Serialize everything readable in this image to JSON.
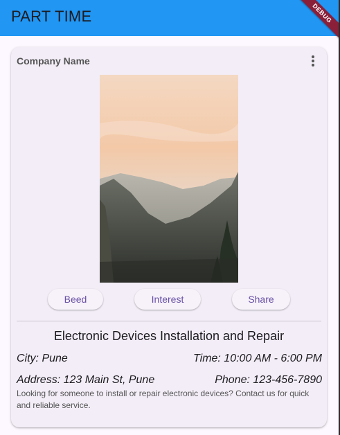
{
  "app_bar": {
    "title": "PART TIME",
    "debug_label": "DEBUG"
  },
  "colors": {
    "app_bar": "#2196f3",
    "card": "#f3edf7",
    "button_text": "#6750a4",
    "debug_banner": "#8a1f3a"
  },
  "card": {
    "company_name": "Company Name",
    "menu_icon": "more-vert-icon",
    "image": "mountain-valley-sunset",
    "actions": {
      "beed": "Beed",
      "interest": "Interest",
      "share": "Share"
    },
    "job_title": "Electronic Devices Installation and Repair",
    "city": "City: Pune",
    "time": "Time: 10:00 AM - 6:00 PM",
    "address": "Address: 123 Main St, Pune",
    "phone": "Phone: 123-456-7890",
    "description": "Looking for someone to install or repair electronic devices? Contact us for quick and reliable service."
  }
}
